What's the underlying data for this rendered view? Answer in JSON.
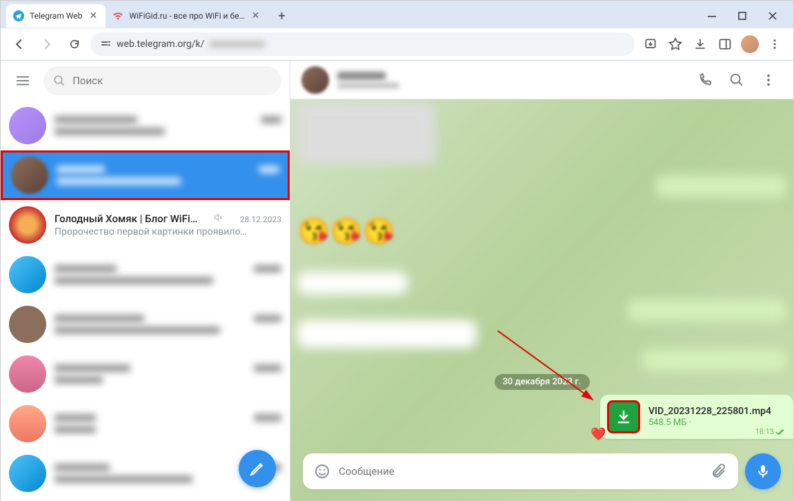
{
  "browser": {
    "tabs": [
      {
        "title": "Telegram Web",
        "active": true
      },
      {
        "title": "WiFiGid.ru - все про WiFi и бе…",
        "active": false
      }
    ],
    "url": "web.telegram.org/k/"
  },
  "sidebar": {
    "search_placeholder": "Поиск",
    "chats": [
      {
        "name": "",
        "preview": "",
        "time": "",
        "selected": false,
        "blur": true
      },
      {
        "name": "",
        "preview": "",
        "time": "",
        "selected": true,
        "blur": true
      },
      {
        "name": "Голодный Хомяк | Блог WiFi…",
        "preview": "Пророчество первой картинки проявило…",
        "time": "28.12.2023",
        "muted": true
      },
      {
        "name": "",
        "preview": "",
        "time": "",
        "blur": true
      },
      {
        "name": "",
        "preview": "",
        "time": "",
        "blur": true
      },
      {
        "name": "",
        "preview": "",
        "time": "",
        "blur": true
      },
      {
        "name": "",
        "preview": "",
        "time": "",
        "blur": true
      },
      {
        "name": "",
        "preview": "",
        "time": "",
        "blur": true
      }
    ]
  },
  "chat": {
    "date_separator": "30 декабря 2023 г.",
    "file_message": {
      "filename": "VID_20231228_225801.mp4",
      "size": "548.5 МБ ·",
      "time": "18:13"
    },
    "composer_placeholder": "Сообщение"
  }
}
